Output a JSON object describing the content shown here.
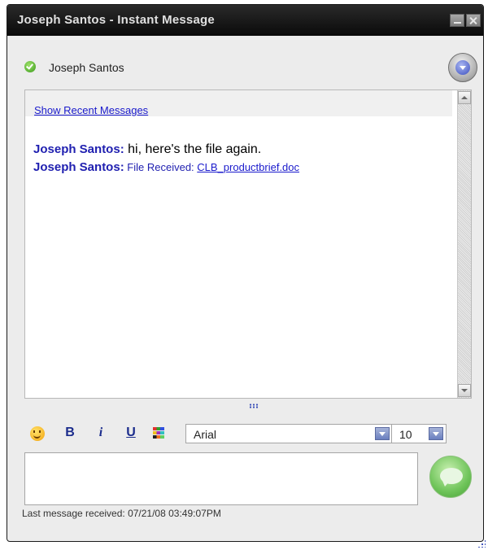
{
  "window": {
    "title": "Joseph Santos - Instant Message"
  },
  "contact": {
    "name": "Joseph Santos",
    "status_icon": "online-check-icon"
  },
  "history": {
    "show_recent_label": "Show Recent Messages",
    "messages": [
      {
        "sender": "Joseph Santos:",
        "text": " hi, here's the file again."
      },
      {
        "sender": "Joseph Santos:",
        "prefix": " File Received: ",
        "file_link": "CLB_productbrief.doc"
      }
    ]
  },
  "toolbar": {
    "emoticon_icon": "smiley-icon",
    "bold_label": "B",
    "italic_label": "i",
    "underline_label": "U",
    "color_icon": "color-palette-icon",
    "font_value": "Arial",
    "size_value": "10"
  },
  "compose": {
    "value": "",
    "send_icon": "speech-bubble-icon"
  },
  "status": {
    "last_received": "Last message received: 07/21/08 03:49:07PM"
  },
  "colors": {
    "title_bg": "#0a0a0a",
    "sender": "#1f1fb0",
    "link": "#1a1acc",
    "send_button": "#6fc45a"
  }
}
